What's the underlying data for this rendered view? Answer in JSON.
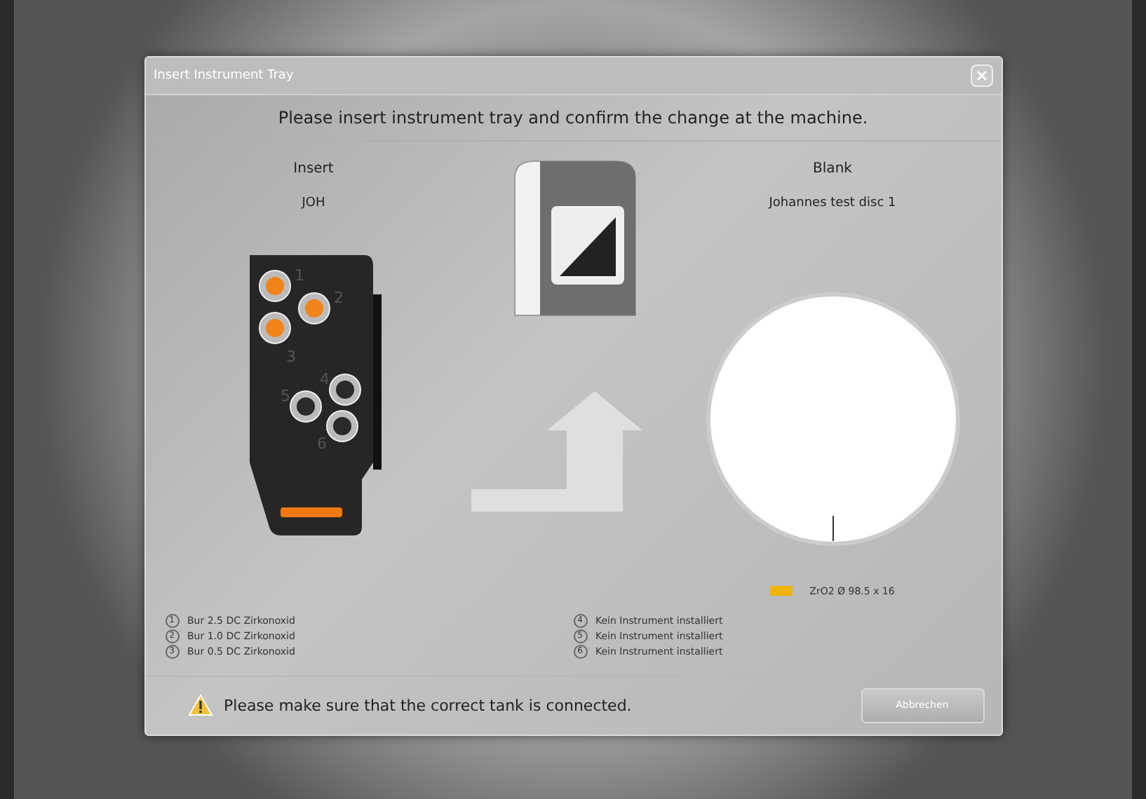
{
  "dialog": {
    "title": "Insert Instrument Tray",
    "instruction": "Please insert instrument tray and confirm the change at the machine.",
    "insert": {
      "heading": "Insert",
      "value": "JOH"
    },
    "blank": {
      "heading": "Blank",
      "value": "Johannes test disc 1",
      "material": "ZrO2 Ø 98.5 x 16",
      "color": "#f0b400"
    },
    "tray_slots": [
      {
        "number": "1",
        "installed": true
      },
      {
        "number": "2",
        "installed": true
      },
      {
        "number": "3",
        "installed": true
      },
      {
        "number": "4",
        "installed": false
      },
      {
        "number": "5",
        "installed": false
      },
      {
        "number": "6",
        "installed": false
      }
    ],
    "instruments": [
      {
        "number": "1",
        "label": "Bur 2.5 DC Zirkonoxid"
      },
      {
        "number": "2",
        "label": "Bur 1.0 DC Zirkonoxid"
      },
      {
        "number": "3",
        "label": "Bur 0.5 DC Zirkonoxid"
      },
      {
        "number": "4",
        "label": "Kein Instrument installiert"
      },
      {
        "number": "5",
        "label": "Kein Instrument installiert"
      },
      {
        "number": "6",
        "label": "Kein Instrument installiert"
      }
    ],
    "warning": "Please make sure that the correct tank is connected.",
    "buttons": [
      "Abbrechen"
    ]
  }
}
